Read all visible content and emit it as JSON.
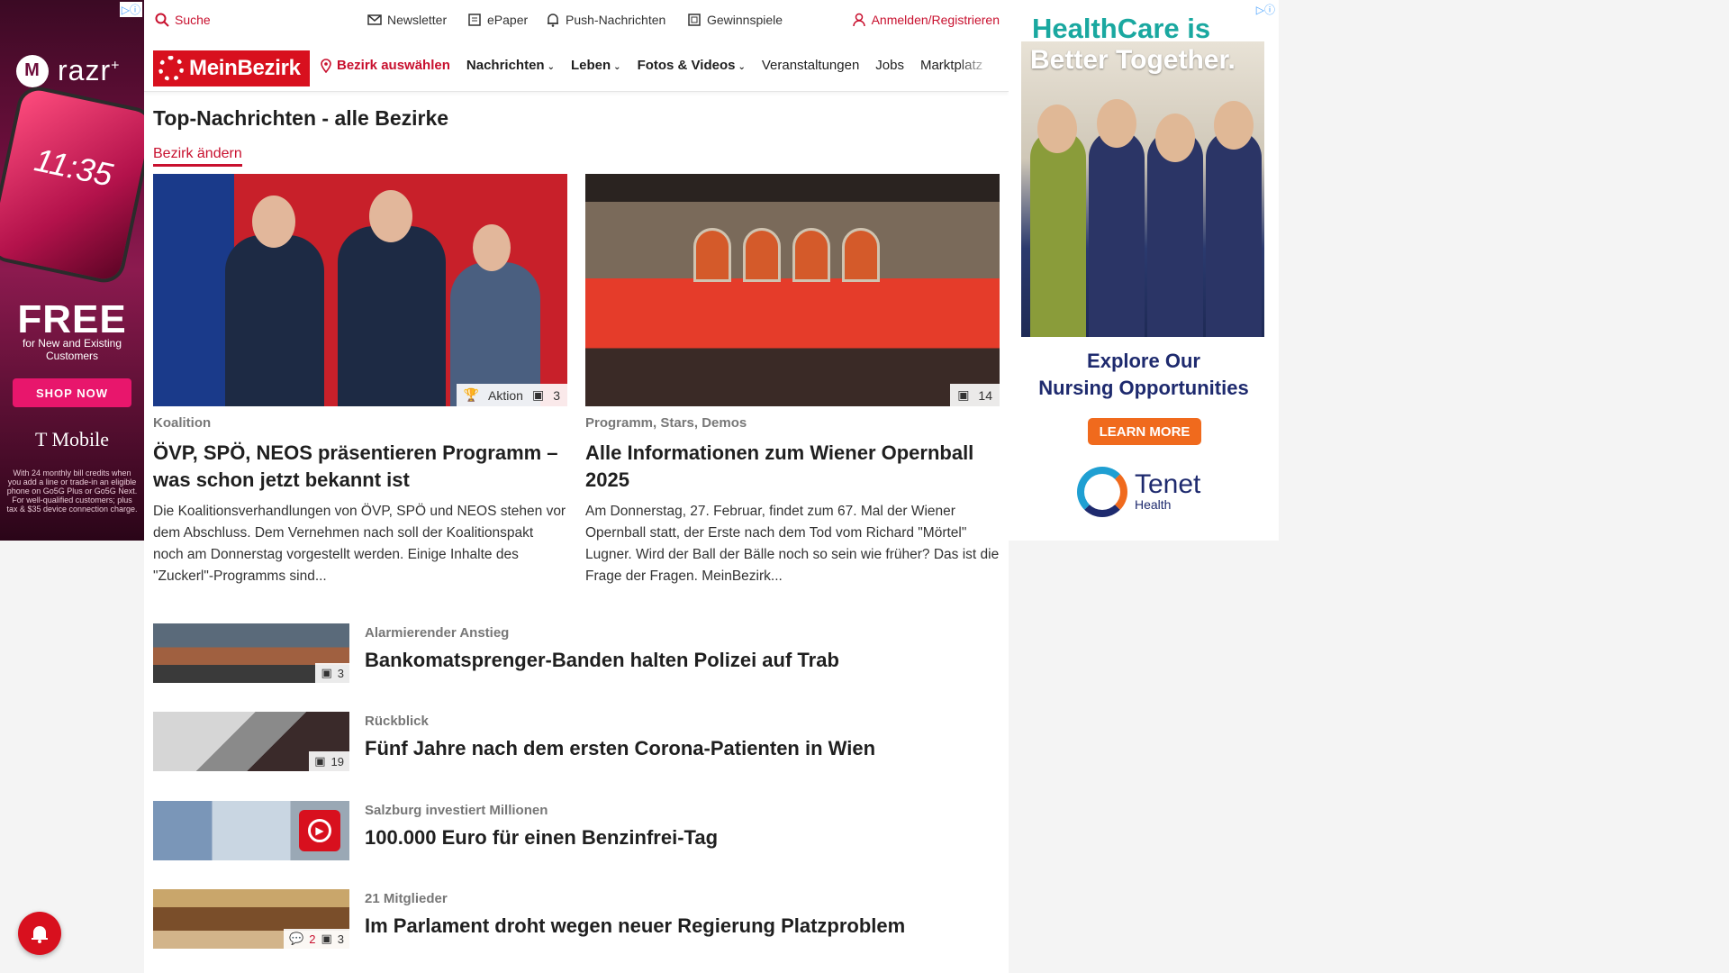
{
  "ads": {
    "left": {
      "brand": "razr",
      "brand_sup": "+",
      "phone_time": "11:35",
      "headline": "FREE",
      "sub": "for New and Existing Customers",
      "cta": "SHOP NOW",
      "advertiser": "T Mobile",
      "fine_print": "With 24 monthly bill credits when you add a line or trade-in an eligible phone on Go5G Plus or Go5G Next. For well-qualified customers; plus tax & $35 device connection charge."
    },
    "right": {
      "headline_1": "HealthCare is",
      "headline_2": "Better Together.",
      "explore_1": "Explore Our",
      "explore_2": "Nursing Opportunities",
      "cta": "LEARN MORE",
      "brand": "Tenet",
      "brand_sub": "Health"
    }
  },
  "topbar": {
    "search": "Suche",
    "newsletter": "Newsletter",
    "epaper": "ePaper",
    "push": "Push-Nachrichten",
    "gewinnspiele": "Gewinnspiele",
    "login": "Anmelden/Registrieren"
  },
  "nav": {
    "logo": "MeinBezirk",
    "bezirk": "Bezirk auswählen",
    "items": [
      "Nachrichten",
      "Leben",
      "Fotos & Videos",
      "Veranstaltungen",
      "Jobs",
      "Marktplatz"
    ]
  },
  "section": {
    "title": "Top-Nachrichten - alle Bezirke",
    "change": "Bezirk ändern"
  },
  "features": [
    {
      "kicker": "Koalition",
      "headline": "ÖVP, SPÖ, NEOS präsentieren Programm – was schon jetzt bekannt ist",
      "teaser": "Die Koalitionsverhandlungen von ÖVP, SPÖ und NEOS stehen vor dem Abschluss. Dem Vernehmen nach soll der Koalitionspakt noch am Donnerstag vorgestellt werden. Einige Inhalte des \"Zuckerl\"-Programms sind...",
      "badge_label": "Aktion",
      "photo_count": "3"
    },
    {
      "kicker": "Programm, Stars, Demos",
      "headline": "Alle Informationen zum Wiener Opernball 2025",
      "teaser": "Am Donnerstag, 27. Februar, findet zum 67. Mal der Wiener Opernball statt, der Erste nach dem Tod vom Richard \"Mörtel\" Lugner. Wird der Ball der Bälle noch so sein wie früher? Das ist die Frage der Fragen. MeinBezirk...",
      "photo_count": "14"
    }
  ],
  "list": [
    {
      "kicker": "Alarmierender Anstieg",
      "headline": "Bankomatsprenger-Banden halten Polizei auf Trab",
      "photo_count": "3"
    },
    {
      "kicker": "Rückblick",
      "headline": "Fünf Jahre nach dem ersten Corona-Patienten in Wien",
      "photo_count": "19"
    },
    {
      "kicker": "Salzburg investiert Millionen",
      "headline": "100.000 Euro für einen Benzinfrei-Tag"
    },
    {
      "kicker": "21 Mitglieder",
      "headline": "Im Parlament droht wegen neuer Regierung Platzproblem",
      "comment_count": "2",
      "photo_count": "3"
    }
  ],
  "colors": {
    "brand_red": "#d8101e",
    "link_red": "#c8102e"
  }
}
